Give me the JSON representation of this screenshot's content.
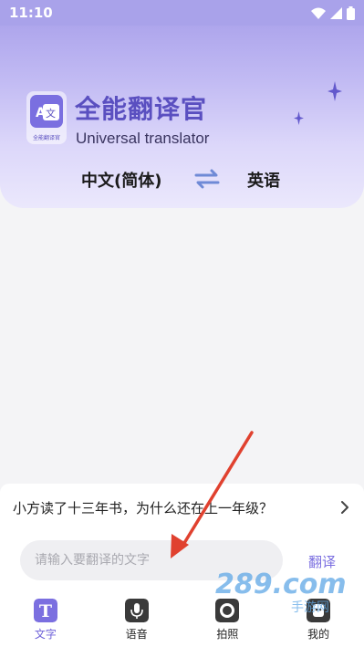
{
  "status_bar": {
    "time": "11:10",
    "icons": [
      "wifi-icon",
      "signal-icon",
      "battery-icon"
    ]
  },
  "header": {
    "title": "全能翻译官",
    "subtitle": "Universal translator",
    "logo_caption": "全能翻译官",
    "logo_glyph_a": "A",
    "logo_glyph_wen": "文",
    "source_language": "中文(简体)",
    "target_language": "英语",
    "swap_icon": "swap-arrows-icon"
  },
  "suggestion": {
    "text": "小方读了十三年书，为什么还在上一年级？",
    "chevron_icon": "chevron-right-icon"
  },
  "input": {
    "placeholder": "请输入要翻译的文字",
    "value": "",
    "translate_label": "翻译"
  },
  "tabs": [
    {
      "label": "文字",
      "icon": "text-icon",
      "glyph": "T",
      "active": true
    },
    {
      "label": "语音",
      "icon": "microphone-icon",
      "active": false
    },
    {
      "label": "拍照",
      "icon": "camera-icon",
      "active": false
    },
    {
      "label": "我的",
      "icon": "profile-icon",
      "active": false
    }
  ],
  "watermark": {
    "logo_text": "289.com",
    "caption": "手游网"
  },
  "colors": {
    "accent": "#6c5fd8",
    "hero_gradient_top": "#a59ce9",
    "hero_gradient_bottom": "#ebe8fc",
    "annotation_arrow": "#e0412f",
    "tab_icon_inactive": "#3a3a3a"
  }
}
